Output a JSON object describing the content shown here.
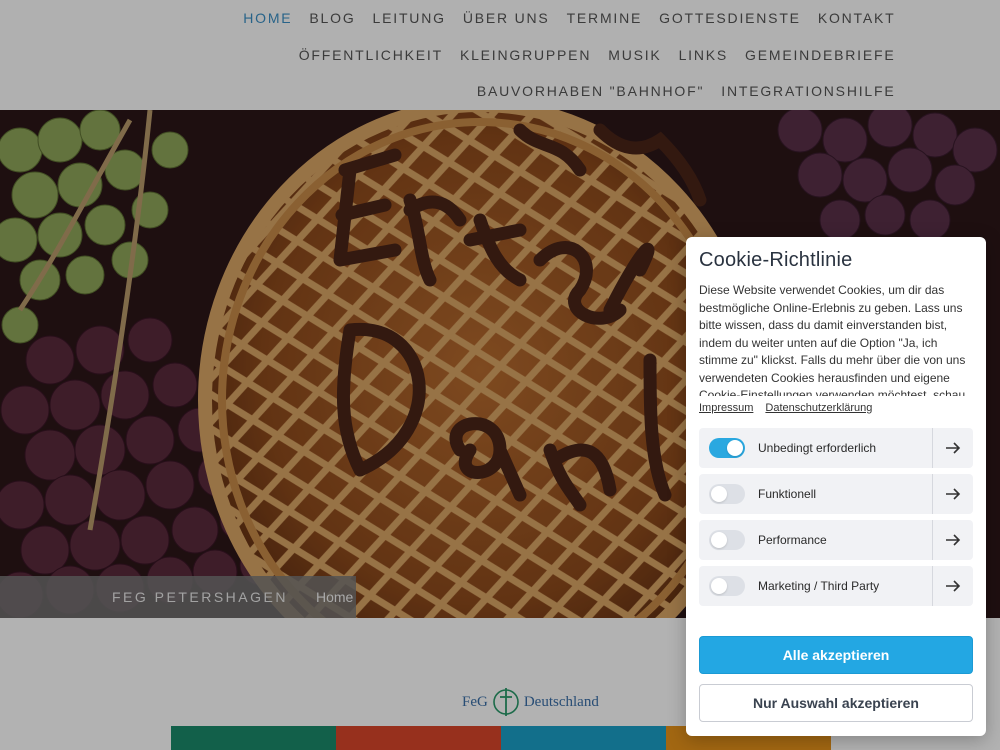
{
  "nav": {
    "row1": [
      "HOME",
      "BLOG",
      "LEITUNG",
      "ÜBER UNS",
      "TERMINE",
      "GOTTESDIENSTE",
      "KONTAKT"
    ],
    "row2": [
      "ÖFFENTLICHKEIT",
      "KLEINGRUPPEN",
      "MUSIK",
      "LINKS",
      "GEMEINDEBRIEFE"
    ],
    "row3": [
      "BAUVORHABEN \"BAHNHOF\"",
      "INTEGRATIONSHILFE"
    ],
    "active": "HOME"
  },
  "breadcrumb": {
    "site": "FEG PETERSHAGEN",
    "separator": "",
    "home": "Home"
  },
  "logo": {
    "left": "FeG",
    "right": "Deutschland"
  },
  "cookie": {
    "title": "Cookie-Richtlinie",
    "text": "Diese Website verwendet Cookies, um dir das bestmögliche Online-Erlebnis zu geben. Lass uns bitte wissen, dass du damit einverstanden bist, indem du weiter unten auf die Option \"Ja, ich stimme zu\" klickst. Falls du mehr über die von uns verwendeten Cookies herausfinden und eigene Cookie-Einstellungen verwenden möchtest, schau",
    "links": [
      "Impressum",
      "Datenschutzerklärung"
    ],
    "options": [
      {
        "label": "Unbedingt erforderlich",
        "enabled": true
      },
      {
        "label": "Funktionell",
        "enabled": false
      },
      {
        "label": "Performance",
        "enabled": false
      },
      {
        "label": "Marketing / Third Party",
        "enabled": false
      }
    ],
    "accept_all": "Alle akzeptieren",
    "accept_selection": "Nur Auswahl akzeptieren"
  },
  "colors": {
    "accent": "#23a7e3",
    "nav_active": "#3a8fc4",
    "tiles": [
      "#1a8a6a",
      "#d9452a",
      "#1aa0c8",
      "#e8941a"
    ]
  }
}
